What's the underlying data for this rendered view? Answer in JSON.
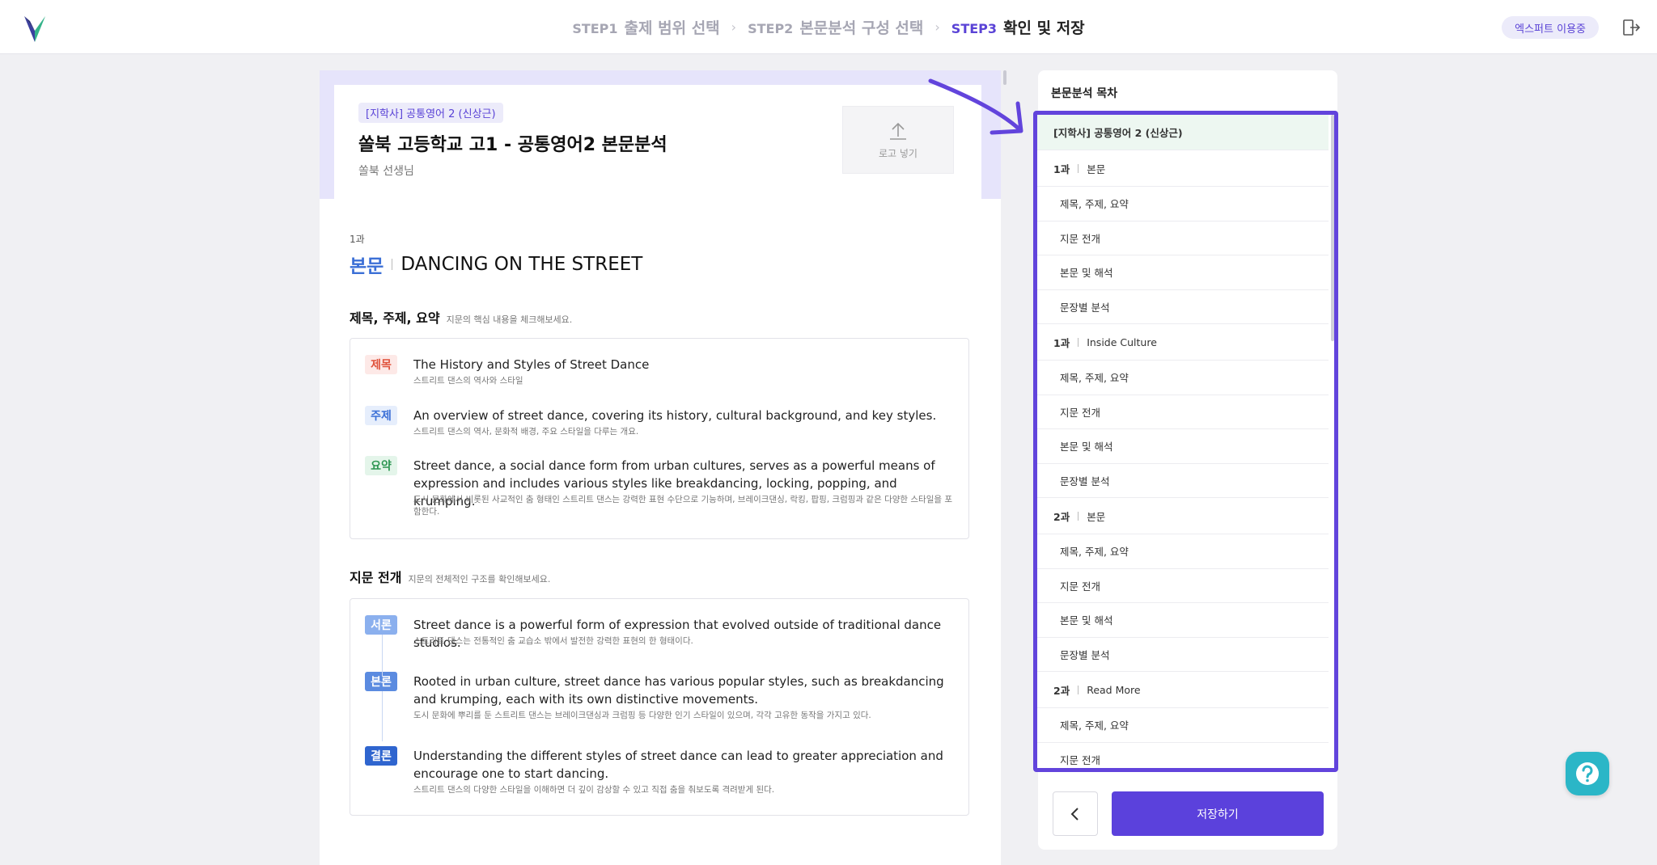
{
  "header": {
    "steps": [
      {
        "num": "STEP1",
        "label": "출제 범위 선택"
      },
      {
        "num": "STEP2",
        "label": "본문분석 구성 선택"
      },
      {
        "num": "STEP3",
        "label": "확인 및 저장"
      }
    ],
    "expert_badge": "엑스퍼트 이용중",
    "colors": {
      "accent": "#5b41dc",
      "step_active": "#5a43d6",
      "step_inactive": "#a6a6b3"
    }
  },
  "document": {
    "tag": "[지학사] 공통영어 2 (신상근)",
    "title": "쏠북 고등학교 고1 - 공통영어2 본문분석",
    "teacher": "쏠북 선생님",
    "logo_label": "로고 넣기",
    "lesson_no": "1과",
    "lesson_kind": "본문",
    "lesson_name": "DANCING ON THE STREET",
    "summary_section": {
      "heading": "제목, 주제, 요약",
      "desc": "지문의 핵심 내용을 체크해보세요.",
      "rows": [
        {
          "label": "제목",
          "en": "The History and Styles of Street Dance",
          "ko": "스트리트 댄스의 역사와 스타일"
        },
        {
          "label": "주제",
          "en": "An overview of street dance, covering its history, cultural background, and key styles.",
          "ko": "스트리트 댄스의 역사, 문화적 배경, 주요 스타일을 다루는 개요."
        },
        {
          "label": "요약",
          "en": "Street dance, a social dance form from urban cultures, serves as a powerful means of expression and includes various styles like breakdancing, locking, popping, and krumping.",
          "ko": "도시 문화에서 비롯된 사교적인 춤 형태인 스트리트 댄스는 강력한 표현 수단으로 기능하며, 브레이크댄싱, 락킹, 팝핑, 크럼핑과 같은 다양한 스타일을 포함한다."
        }
      ]
    },
    "structure_section": {
      "heading": "지문 전개",
      "desc": "지문의 전체적인 구조를 확인해보세요.",
      "rows": [
        {
          "label": "서론",
          "en": "Street dance is a powerful form of expression that evolved outside of traditional dance studios.",
          "ko": "스트리트 댄스는 전통적인 춤 교습소 밖에서 발전한 강력한 표현의 한 형태이다."
        },
        {
          "label": "본론",
          "en": "Rooted in urban culture, street dance has various popular styles, such as breakdancing and krumping, each with its own distinctive movements.",
          "ko": "도시 문화에 뿌리를 둔 스트리트 댄스는 브레이크댄싱과 크럼핑 등 다양한 인기 스타일이 있으며, 각각 고유한 동작을 가지고 있다."
        },
        {
          "label": "결론",
          "en": "Understanding the different styles of street dance can lead to greater appreciation and encourage one to start dancing.",
          "ko": "스트리트 댄스의 다양한 스타일을 이해하면 더 깊이 감상할 수 있고 직접 춤을 춰보도록 격려받게 된다."
        }
      ]
    }
  },
  "toc": {
    "title": "본문분석 목차",
    "book": "[지학사] 공통영어 2 (신상근)",
    "chapters": [
      {
        "no": "1과",
        "name": "본문",
        "items": [
          "제목, 주제, 요약",
          "지문 전개",
          "본문 및 해석",
          "문장별 분석"
        ]
      },
      {
        "no": "1과",
        "name": "Inside Culture",
        "items": [
          "제목, 주제, 요약",
          "지문 전개",
          "본문 및 해석",
          "문장별 분석"
        ]
      },
      {
        "no": "2과",
        "name": "본문",
        "items": [
          "제목, 주제, 요약",
          "지문 전개",
          "본문 및 해석",
          "문장별 분석"
        ]
      },
      {
        "no": "2과",
        "name": "Read More",
        "items": [
          "제목, 주제, 요약",
          "지문 전개"
        ]
      }
    ],
    "save_label": "저장하기"
  }
}
